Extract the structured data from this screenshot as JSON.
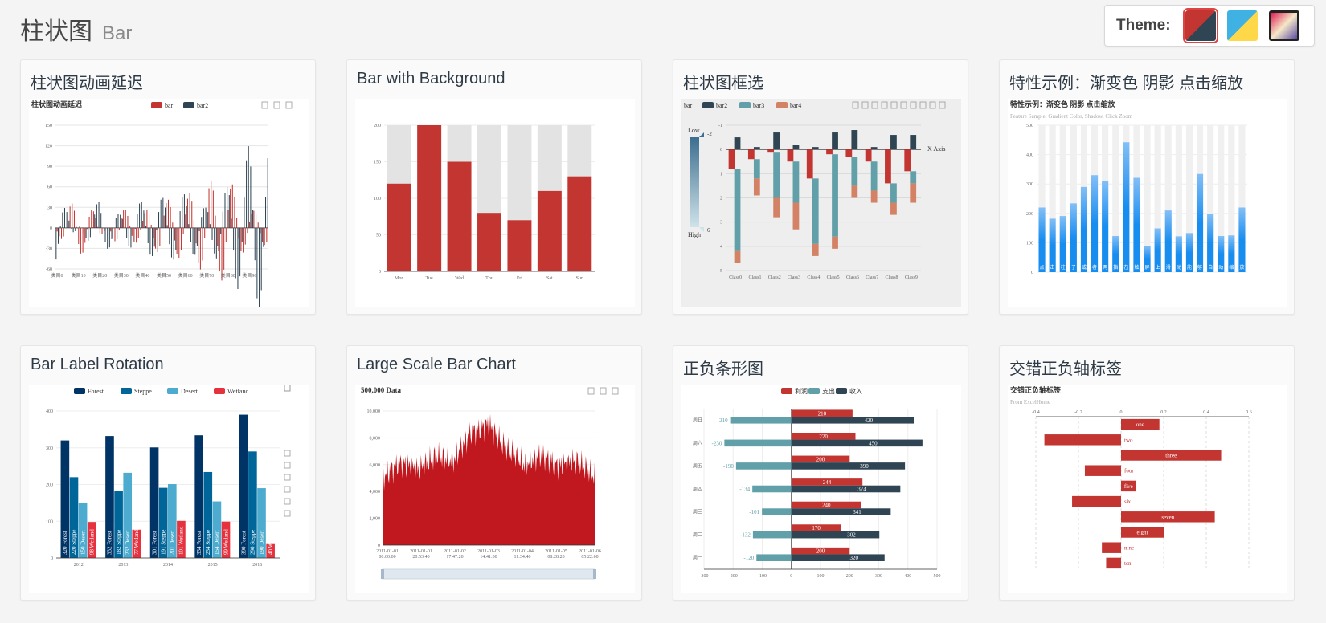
{
  "header": {
    "title": "柱状图",
    "subtitle": "Bar"
  },
  "theme": {
    "label": "Theme:",
    "swatches": [
      "default",
      "light",
      "dark"
    ],
    "active": 0
  },
  "colors": {
    "red": "#c23531",
    "navy": "#2f4554",
    "teal": "#61a0a8",
    "orange": "#d48265",
    "blue": "#188df0"
  },
  "cards": [
    {
      "title": "柱状图动画延迟"
    },
    {
      "title": "Bar with Background"
    },
    {
      "title": "柱状图框选"
    },
    {
      "title": "特性示例：渐变色 阴影 点击缩放"
    },
    {
      "title": "Bar Label Rotation"
    },
    {
      "title": "Large Scale Bar Chart"
    },
    {
      "title": "正负条形图"
    },
    {
      "title": "交错正负轴标签"
    }
  ],
  "chart_data": [
    {
      "type": "bar",
      "title": "柱状图动画延迟",
      "legend": [
        "bar",
        "bar2"
      ],
      "categories": [
        "类目0",
        "类目10",
        "类目20",
        "类目30",
        "类目40",
        "类目50",
        "类目60",
        "类目70",
        "类目80",
        "类目90"
      ],
      "ylim": [
        -60,
        150
      ],
      "yticks": [
        -60,
        -30,
        0,
        30,
        60,
        90,
        120,
        150
      ],
      "series": [
        {
          "name": "bar",
          "values": [
            -5,
            -45,
            -20,
            30,
            20,
            40,
            45,
            65,
            80,
            25
          ]
        },
        {
          "name": "bar2",
          "values": [
            -50,
            0,
            40,
            20,
            40,
            45,
            50,
            30,
            60,
            120
          ]
        }
      ]
    },
    {
      "type": "bar",
      "categories": [
        "Mon",
        "Tue",
        "Wed",
        "Thu",
        "Fri",
        "Sat",
        "Sun"
      ],
      "values": [
        120,
        200,
        150,
        80,
        70,
        110,
        130
      ],
      "background_max": 200,
      "ylim": [
        0,
        200
      ],
      "yticks": [
        0,
        50,
        100,
        150,
        200
      ]
    },
    {
      "type": "bar",
      "legend": [
        "bar",
        "bar2",
        "bar3",
        "bar4"
      ],
      "categories": [
        "Class0",
        "Class1",
        "Class2",
        "Class3",
        "Class4",
        "Class5",
        "Class6",
        "Class7",
        "Class8",
        "Class9"
      ],
      "ylim": [
        -1,
        5
      ],
      "yticks": [
        -1,
        0,
        1,
        2,
        3,
        4,
        5
      ],
      "axis_name": "X Axis",
      "visual_map": {
        "low": "Low",
        "high": "High",
        "min": -2,
        "max": 6
      },
      "series": [
        {
          "name": "bar",
          "values": [
            0.8,
            0.4,
            0.1,
            0.5,
            1.2,
            0.2,
            0.3,
            0.5,
            1.4,
            0.9
          ]
        },
        {
          "name": "bar2",
          "values": [
            -0.5,
            -0.1,
            -0.7,
            -0.2,
            -0.1,
            -0.7,
            -0.8,
            -0.1,
            -0.6,
            -0.6
          ]
        },
        {
          "name": "bar3",
          "values": [
            3.4,
            0.8,
            1.9,
            1.7,
            2.7,
            3.4,
            1.2,
            1.2,
            0.8,
            0.5
          ]
        },
        {
          "name": "bar4",
          "values": [
            0.5,
            0.7,
            0.8,
            1.1,
            0.5,
            0.5,
            0.5,
            0.5,
            0.5,
            0.8
          ]
        }
      ]
    },
    {
      "type": "bar",
      "title": "特性示例：渐变色 阴影 点击缩放",
      "subtitle": "Feature Sample: Gradient Color, Shadow, Click Zoom",
      "ylim": [
        0,
        500
      ],
      "yticks": [
        0,
        100,
        200,
        300,
        400,
        500
      ],
      "categories": [
        "点",
        "击",
        "柱",
        "子",
        "或",
        "者",
        "两",
        "指",
        "在",
        "触",
        "屏",
        "上",
        "滑",
        "动",
        "能",
        "够",
        "自",
        "动",
        "缩",
        "放"
      ],
      "values": [
        220,
        182,
        191,
        234,
        290,
        330,
        310,
        123,
        442,
        321,
        90,
        149,
        210,
        122,
        133,
        334,
        198,
        123,
        125,
        220
      ]
    },
    {
      "type": "bar",
      "legend": [
        "Forest",
        "Steppe",
        "Desert",
        "Wetland"
      ],
      "categories": [
        "2012",
        "2013",
        "2014",
        "2015",
        "2016"
      ],
      "ylim": [
        0,
        400
      ],
      "yticks": [
        0,
        100,
        200,
        300,
        400
      ],
      "series": [
        {
          "name": "Forest",
          "values": [
            320,
            332,
            301,
            334,
            390
          ]
        },
        {
          "name": "Steppe",
          "values": [
            220,
            182,
            191,
            234,
            290
          ]
        },
        {
          "name": "Desert",
          "values": [
            150,
            232,
            201,
            154,
            190
          ]
        },
        {
          "name": "Wetland",
          "values": [
            98,
            77,
            101,
            99,
            40
          ]
        }
      ]
    },
    {
      "type": "bar",
      "title": "500,000 Data",
      "ylim": [
        0,
        10000
      ],
      "yticks": [
        "0",
        "2,000",
        "4,000",
        "6,000",
        "8,000",
        "10,000"
      ],
      "xlabels": [
        [
          "2011-01-01",
          "00:00:00"
        ],
        [
          "2011-01-01",
          "20:53:40"
        ],
        [
          "2011-01-02",
          "17:47:20"
        ],
        [
          "2011-01-03",
          "14:41:00"
        ],
        [
          "2011-01-04",
          "11:34:40"
        ],
        [
          "2011-01-05",
          "08:28:20"
        ],
        [
          "2011-01-06",
          "05:22:00"
        ]
      ],
      "trend": [
        5000,
        6200,
        5600,
        6600,
        6300,
        8400,
        9000,
        7200,
        6000,
        6700,
        5900,
        6300,
        5100
      ]
    },
    {
      "type": "bar",
      "legend": [
        "利润",
        "支出",
        "收入"
      ],
      "categories": [
        "周一",
        "周二",
        "周三",
        "周四",
        "周五",
        "周六",
        "周日"
      ],
      "xlim": [
        -300,
        500
      ],
      "xticks": [
        -300,
        -200,
        -100,
        0,
        100,
        200,
        300,
        400,
        500
      ],
      "series": [
        {
          "name": "利润",
          "values": [
            200,
            170,
            240,
            244,
            200,
            220,
            210
          ]
        },
        {
          "name": "支出",
          "values": [
            -120,
            -132,
            -101,
            -134,
            -190,
            -230,
            -210
          ]
        },
        {
          "name": "收入",
          "values": [
            320,
            302,
            341,
            374,
            390,
            450,
            420
          ]
        }
      ]
    },
    {
      "type": "bar",
      "title": "交错正负轴标签",
      "subtitle": "From ExcelHome",
      "xlim": [
        -0.4,
        0.6
      ],
      "xticks": [
        "-0.4",
        "-0.2",
        "0",
        "0.2",
        "0.4",
        "0.6"
      ],
      "categories": [
        "one",
        "two",
        "three",
        "four",
        "five",
        "six",
        "seven",
        "eight",
        "nine",
        "ten"
      ],
      "values": [
        0.18,
        -0.36,
        0.47,
        -0.17,
        0.07,
        -0.23,
        0.44,
        0.2,
        -0.09,
        -0.07
      ]
    }
  ]
}
